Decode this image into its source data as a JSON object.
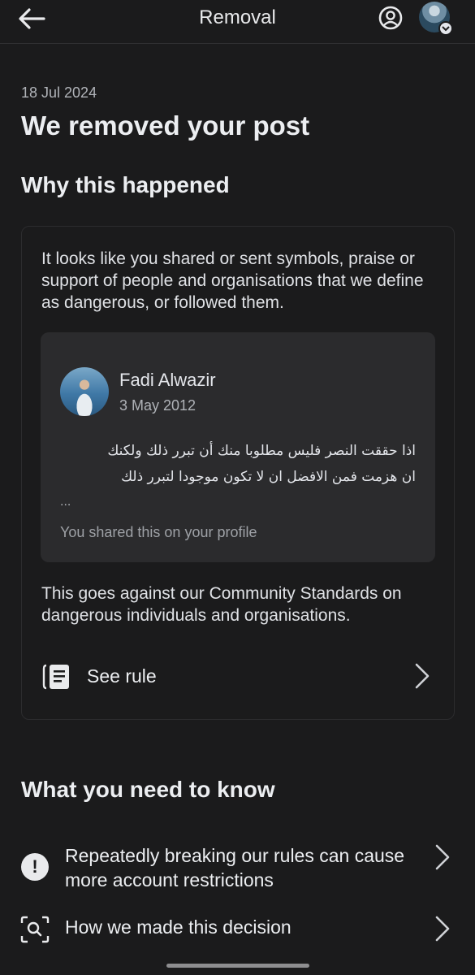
{
  "header": {
    "title": "Removal",
    "back_icon": "arrow-left-icon",
    "account_icon": "account-circle-icon"
  },
  "notice": {
    "date": "18 Jul 2024",
    "headline": "We removed your post",
    "why_heading": "Why this happened",
    "explanation": "It looks like you shared or sent symbols, praise or support of people and organisations that we define as dangerous, or followed them."
  },
  "post": {
    "author": "Fadi Alwazir",
    "date": "3 May 2012",
    "text_line1": "اذا حققت النصر فليس مطلوبا منك أن تبرر ذلك ولكنك",
    "text_line2": "ان هزمت فمن الافضل ان لا تكون موجودا لتبرر ذلك",
    "ellipsis": "...",
    "shared_note": "You shared this on your profile"
  },
  "rule": {
    "standards_text": "This goes against our Community Standards on dangerous individuals and organisations.",
    "see_rule_label": "See rule"
  },
  "know": {
    "heading": "What you need to know",
    "repeat_label": "Repeatedly breaking our rules can cause more account restrictions",
    "decision_label": "How we made this decision"
  },
  "colors": {
    "background": "#1b1b1c",
    "card_inner": "#2b2b2d",
    "text_primary": "#e4e6eb",
    "text_secondary": "#b0b3b8"
  }
}
